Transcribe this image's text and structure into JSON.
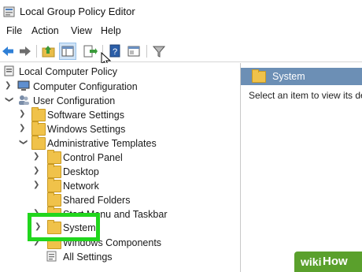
{
  "window": {
    "title": "Local Group Policy Editor"
  },
  "menu": {
    "file": "File",
    "action": "Action",
    "view": "View",
    "help": "Help"
  },
  "toolbar": {
    "icons": [
      "back-icon",
      "forward-icon",
      "up-folder-icon",
      "show-hide-tree-icon",
      "export-list-icon",
      "help-icon",
      "properties-icon",
      "filter-icon"
    ]
  },
  "tree": {
    "root": "Local Computer Policy",
    "computer_configuration": "Computer Configuration",
    "user_configuration": "User Configuration",
    "software_settings": "Software Settings",
    "windows_settings": "Windows Settings",
    "administrative_templates": "Administrative Templates",
    "control_panel": "Control Panel",
    "desktop": "Desktop",
    "network": "Network",
    "shared_folders": "Shared Folders",
    "start_menu_taskbar": "Start Menu and Taskbar",
    "system": "System",
    "windows_components": "Windows Components",
    "all_settings": "All Settings"
  },
  "details": {
    "header": "System",
    "message": "Select an item to view its de"
  },
  "watermark": {
    "part1": "wiki",
    "part2": "How"
  },
  "colors": {
    "highlight": "#21d61d",
    "header_bg": "#6c8fb5",
    "folder": "#f0c24a"
  }
}
